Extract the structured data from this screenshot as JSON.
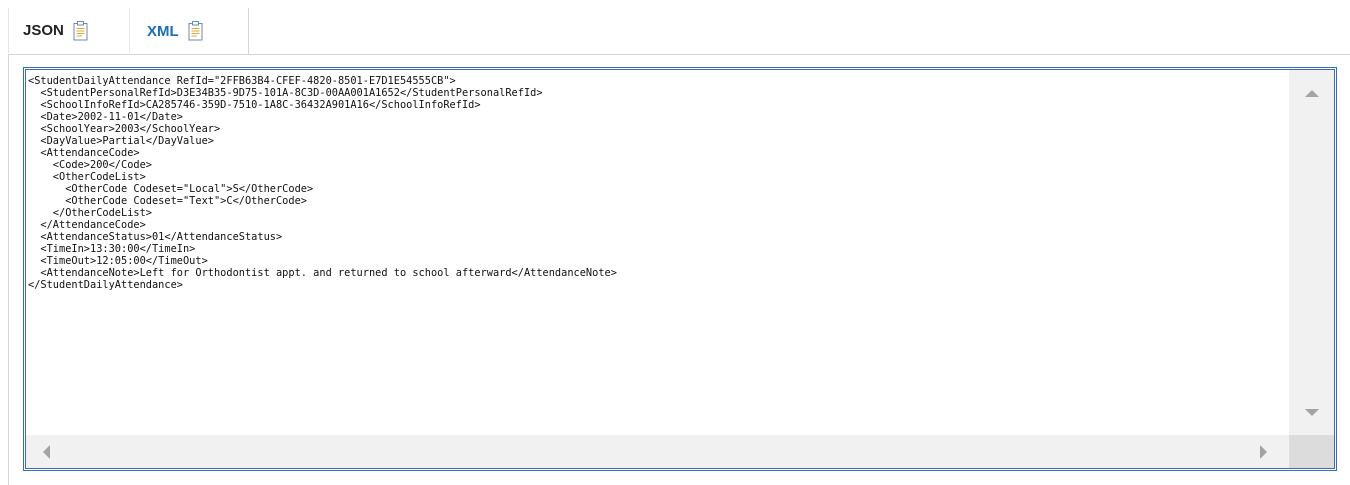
{
  "tabs": [
    {
      "label": "JSON",
      "icon": "clipboard-icon",
      "active": false
    },
    {
      "label": "XML",
      "icon": "clipboard-icon",
      "active": true
    }
  ],
  "colors": {
    "active_tab": "#1a6fb5",
    "panel_border": "#3a6db3"
  },
  "code": {
    "lines": [
      "<StudentDailyAttendance RefId=\"2FFB63B4-CFEF-4820-8501-E7D1E54555CB\">",
      "  <StudentPersonalRefId>D3E34B35-9D75-101A-8C3D-00AA001A1652</StudentPersonalRefId>",
      "  <SchoolInfoRefId>CA285746-359D-7510-1A8C-36432A901A16</SchoolInfoRefId>",
      "  <Date>2002-11-01</Date>",
      "  <SchoolYear>2003</SchoolYear>",
      "  <DayValue>Partial</DayValue>",
      "  <AttendanceCode>",
      "    <Code>200</Code>",
      "    <OtherCodeList>",
      "      <OtherCode Codeset=\"Local\">S</OtherCode>",
      "      <OtherCode Codeset=\"Text\">C</OtherCode>",
      "    </OtherCodeList>",
      "  </AttendanceCode>",
      "  <AttendanceStatus>01</AttendanceStatus>",
      "  <TimeIn>13:30:00</TimeIn>",
      "  <TimeOut>12:05:00</TimeOut>",
      "  <AttendanceNote>Left for Orthodontist appt. and returned to school afterward</AttendanceNote>",
      "</StudentDailyAttendance>"
    ]
  }
}
